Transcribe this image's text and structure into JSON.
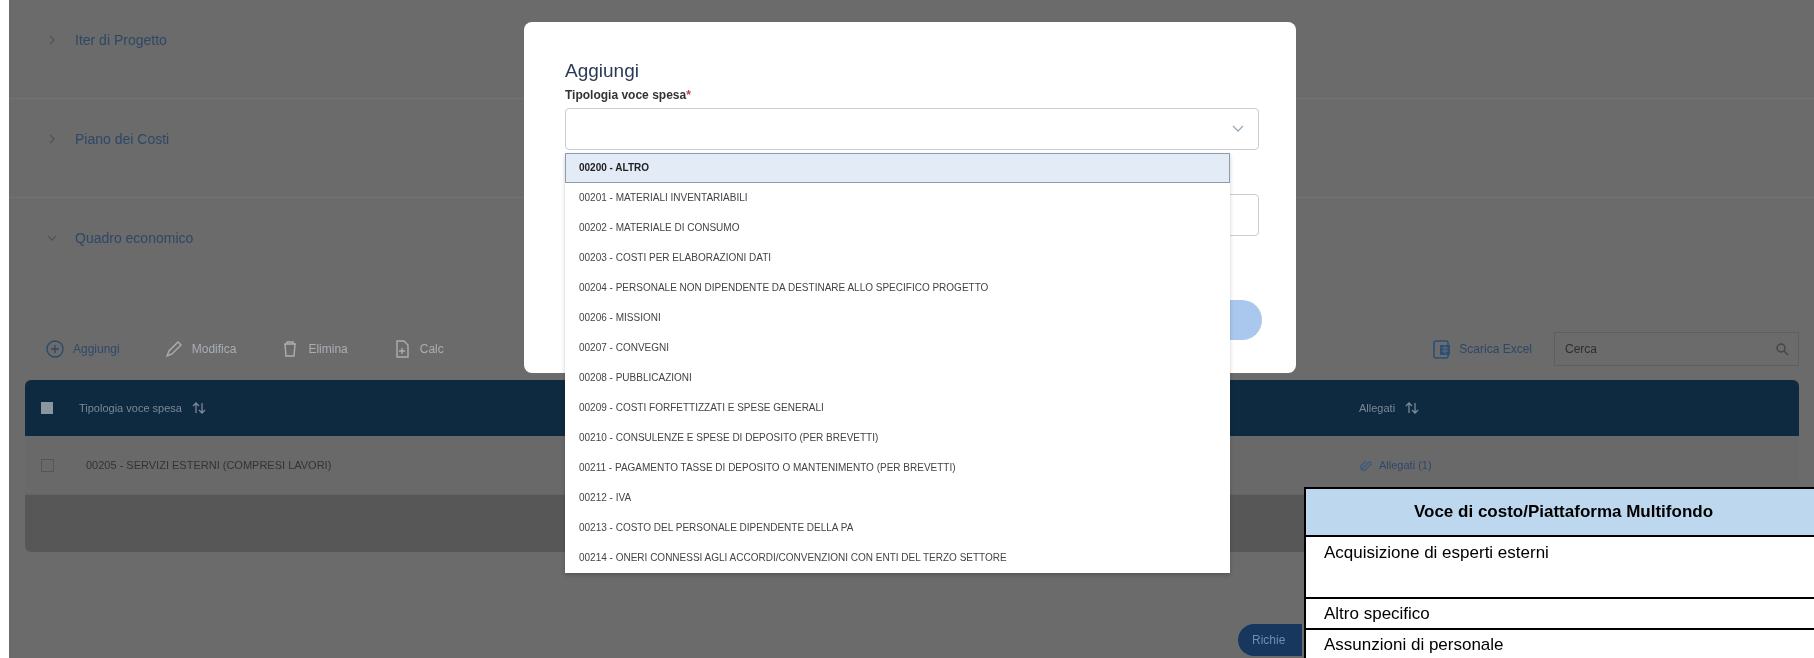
{
  "sections": [
    {
      "title": "Iter di Progetto",
      "expanded": false
    },
    {
      "title": "Piano dei Costi",
      "expanded": false
    },
    {
      "title": "Quadro economico",
      "expanded": true
    }
  ],
  "toolbar": {
    "actions": [
      {
        "kind": "add",
        "label": "Aggiungi",
        "disabled": false
      },
      {
        "kind": "edit",
        "label": "Modifica",
        "disabled": true
      },
      {
        "kind": "delete",
        "label": "Elimina",
        "disabled": true
      },
      {
        "kind": "calc",
        "label": "Calc",
        "disabled": true
      }
    ],
    "export_label": "Scarica Excel",
    "search": {
      "placeholder": "Cerca"
    }
  },
  "table": {
    "select_all_checked": false,
    "columns": [
      "Tipologia voce spesa",
      "Allegati"
    ],
    "rows": [
      {
        "checked": false,
        "tipologia": "00205 - SERVIZI ESTERNI (COMPRESI LAVORI)",
        "allegati": "Allegati (1)"
      }
    ]
  },
  "footer_button": "Richie",
  "dialog": {
    "title": "Aggiungi",
    "field_label": "Tipologia voce spesa",
    "required_mark": "*",
    "options": [
      {
        "label": "00200 - ALTRO",
        "selected": true
      },
      {
        "label": "00201 - MATERIALI INVENTARIABILI",
        "selected": false
      },
      {
        "label": "00202 - MATERIALE DI CONSUMO",
        "selected": false
      },
      {
        "label": "00203 - COSTI PER ELABORAZIONI DATI",
        "selected": false
      },
      {
        "label": "00204 - PERSONALE NON DIPENDENTE DA DESTINARE ALLO SPECIFICO PROGETTO",
        "selected": false
      },
      {
        "label": "00206 - MISSIONI",
        "selected": false
      },
      {
        "label": "00207 - CONVEGNI",
        "selected": false
      },
      {
        "label": "00208 - PUBBLICAZIONI",
        "selected": false
      },
      {
        "label": "00209 - COSTI FORFETTIZZATI E SPESE GENERALI",
        "selected": false
      },
      {
        "label": "00210 - CONSULENZE E SPESE DI DEPOSITO (PER BREVETTI)",
        "selected": false
      },
      {
        "label": "00211 - PAGAMENTO TASSE DI DEPOSITO O MANTENIMENTO (PER BREVETTI)",
        "selected": false
      },
      {
        "label": "00212 - IVA",
        "selected": false
      },
      {
        "label": "00213 - COSTO DEL PERSONALE DIPENDENTE DELLA PA",
        "selected": false
      },
      {
        "label": "00214 - ONERI CONNESSI AGLI ACCORDI/CONVENZIONI CON ENTI DEL TERZO SETTORE",
        "selected": false
      }
    ]
  },
  "overlay_table": {
    "header": "Voce di costo/Piattaforma Multifondo",
    "rows": [
      {
        "kind": "tall",
        "text": "Acquisizione di esperti esterni"
      },
      {
        "kind": "short",
        "text": "Altro specifico"
      },
      {
        "kind": "short",
        "text": "Assunzioni di personale"
      }
    ]
  }
}
